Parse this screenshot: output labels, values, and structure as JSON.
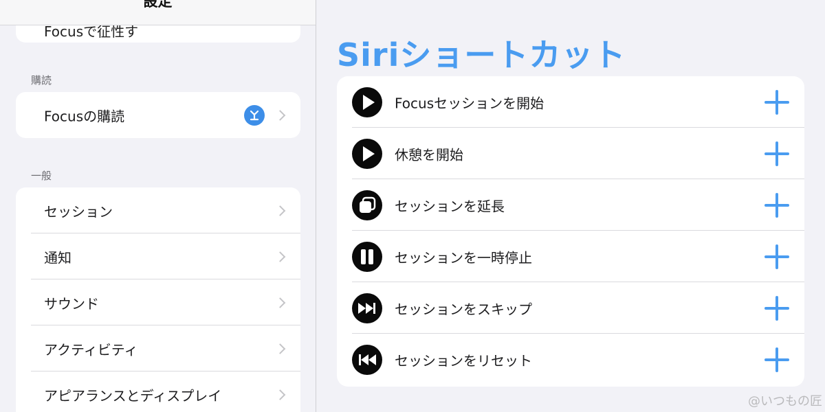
{
  "sidebar": {
    "title": "設定",
    "top_item": "Focusで征性す",
    "subscription_section_label": "購読",
    "subscription_item": "Focusの購読",
    "general_section_label": "一般",
    "general_items": [
      {
        "label": "セッション"
      },
      {
        "label": "通知"
      },
      {
        "label": "サウンド"
      },
      {
        "label": "アクティビティ"
      },
      {
        "label": "アピアランスとディスプレイ"
      }
    ]
  },
  "main": {
    "title": "Siriショートカット",
    "shortcuts": [
      {
        "label": "Focusセッションを開始",
        "icon": "play-icon"
      },
      {
        "label": "休憩を開始",
        "icon": "play-icon"
      },
      {
        "label": "セッションを延長",
        "icon": "extend-icon"
      },
      {
        "label": "セッションを一時停止",
        "icon": "pause-icon"
      },
      {
        "label": "セッションをスキップ",
        "icon": "skip-forward-icon"
      },
      {
        "label": "セッションをリセット",
        "icon": "rewind-icon"
      }
    ],
    "add_icon": "plus-icon"
  },
  "watermark": "@いつもの匠",
  "colors": {
    "accent": "#4a9cf0",
    "background": "#f2f2f7",
    "card": "#ffffff",
    "badge": "#3d8ee8",
    "icon_bg": "#0a0a0a"
  }
}
